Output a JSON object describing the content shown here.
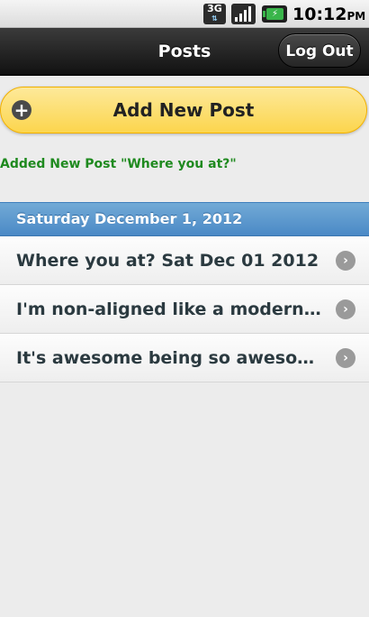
{
  "status_bar": {
    "network_label": "3G",
    "network_arrows": "⇅",
    "battery_label": "⚡",
    "time": "10:12",
    "ampm": "PM"
  },
  "header": {
    "title": "Posts",
    "logout_label": "Log Out"
  },
  "add_post": {
    "icon": "plus-icon",
    "label": "Add New Post"
  },
  "status_message": "Added New Post \"Where you at?\"",
  "list": {
    "date_label": "Saturday December 1, 2012",
    "posts": [
      {
        "title": "Where you at? Sat Dec 01 2012"
      },
      {
        "title": "I'm non-aligned like a modern Turtle"
      },
      {
        "title": "It's awesome being so awesome..."
      }
    ]
  },
  "colors": {
    "accent_yellow": "#fcd54d",
    "divider_blue": "#4a89c6",
    "success_green": "#1f8a1f"
  }
}
